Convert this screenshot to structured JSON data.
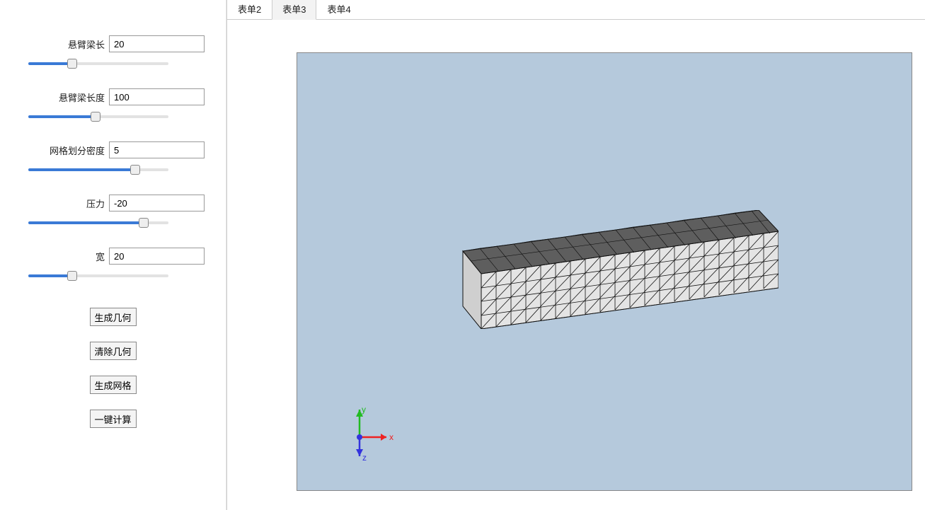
{
  "sidebar": {
    "params": [
      {
        "id": "beam-length",
        "label": "悬臂梁长",
        "value": "20",
        "slider_pct": 30
      },
      {
        "id": "beam-longlen",
        "label": "悬臂梁长度",
        "value": "100",
        "slider_pct": 48
      },
      {
        "id": "mesh-density",
        "label": "网格划分密度",
        "value": "5",
        "slider_pct": 78
      },
      {
        "id": "pressure",
        "label": "压力",
        "value": "-20",
        "slider_pct": 85
      },
      {
        "id": "width",
        "label": "宽",
        "value": "20",
        "slider_pct": 30
      }
    ],
    "buttons": {
      "generate_geom": "生成几何",
      "clear_geom": "清除几何",
      "generate_mesh": "生成网格",
      "one_click_calc": "一键计算"
    }
  },
  "tabs": {
    "items": [
      "表单2",
      "表单3",
      "表单4"
    ],
    "active_index": 1
  },
  "toolbar": {
    "icons": [
      {
        "name": "camera-icon",
        "active": true,
        "dropdown": false
      },
      {
        "name": "wireframe-cube-icon",
        "active": false,
        "dropdown": true
      },
      {
        "name": "move-icon",
        "active": false,
        "dropdown": false
      },
      {
        "name": "axis-xyz-icon",
        "active": false,
        "dropdown": true,
        "noborder": true
      },
      {
        "name": "rotate-left-icon",
        "active": false,
        "dropdown": false,
        "noborder": true
      },
      {
        "name": "rotate-right-icon",
        "active": false,
        "dropdown": false,
        "noborder": true
      }
    ]
  },
  "axes": {
    "x": "x",
    "y": "y",
    "z": "z"
  },
  "viewport": {
    "background_color": "#b5c9dc",
    "mesh_top_color": "#5e5e5e",
    "mesh_front_color": "#e4e4e4"
  }
}
